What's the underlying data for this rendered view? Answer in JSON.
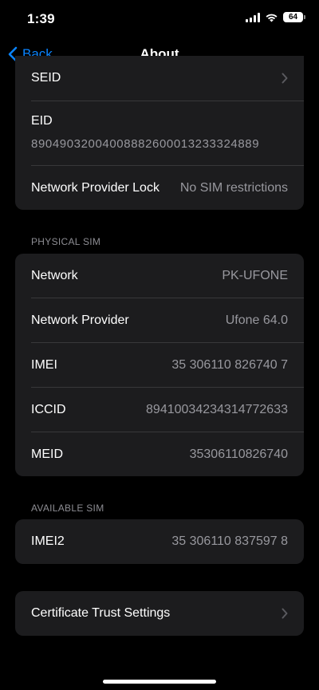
{
  "status": {
    "time": "1:39",
    "battery": "64"
  },
  "nav": {
    "back_label": "Back",
    "title": "About"
  },
  "top_group": {
    "seid_label": "SEID",
    "eid_label": "EID",
    "eid_value": "89049032004008882600013233324889",
    "lock_label": "Network Provider Lock",
    "lock_value": "No SIM restrictions"
  },
  "physical_sim": {
    "header": "PHYSICAL SIM",
    "rows": [
      {
        "label": "Network",
        "value": "PK-UFONE"
      },
      {
        "label": "Network Provider",
        "value": "Ufone 64.0"
      },
      {
        "label": "IMEI",
        "value": "35 306110 826740 7"
      },
      {
        "label": "ICCID",
        "value": "89410034234314772633"
      },
      {
        "label": "MEID",
        "value": "35306110826740"
      }
    ]
  },
  "available_sim": {
    "header": "AVAILABLE SIM",
    "rows": [
      {
        "label": "IMEI2",
        "value": "35 306110 837597 8"
      }
    ]
  },
  "certificate": {
    "label": "Certificate Trust Settings"
  },
  "icons": [
    "signal-icon",
    "wifi-icon",
    "battery-icon",
    "back-chevron-icon",
    "chevron-right-icon"
  ],
  "colors": {
    "accent": "#0a84ff",
    "background": "#000000",
    "card": "#1c1c1e",
    "secondary_text": "#98989e"
  }
}
